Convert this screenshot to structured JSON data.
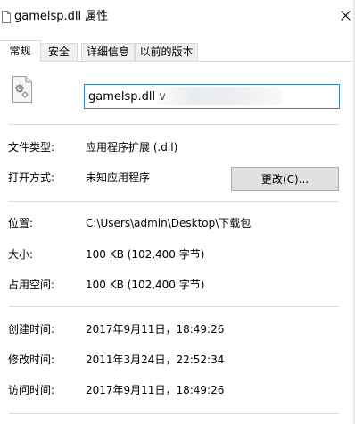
{
  "window": {
    "title": "gamelsp.dll 属性"
  },
  "tabs": [
    {
      "label": "常规"
    },
    {
      "label": "安全"
    },
    {
      "label": "详细信息"
    },
    {
      "label": "以前的版本"
    }
  ],
  "file": {
    "name": "gamelsp.dll v"
  },
  "details": {
    "type_label": "文件类型:",
    "type_value": "应用程序扩展 (.dll)",
    "open_label": "打开方式:",
    "open_value": "未知应用程序",
    "change_button": "更改(C)...",
    "location_label": "位置:",
    "location_value": "C:\\Users\\admin\\Desktop\\下载包",
    "size_label": "大小:",
    "size_value": "100 KB (102,400 字节)",
    "disk_label": "占用空间:",
    "disk_value": "100 KB (102,400 字节)",
    "created_label": "创建时间:",
    "created_value": "2017年9月11日，18:49:26",
    "modified_label": "修改时间:",
    "modified_value": "2011年3月24日，22:52:34",
    "accessed_label": "访问时间:",
    "accessed_value": "2017年9月11日，18:49:26"
  },
  "icons": {
    "title": "document-icon",
    "close": "close-icon",
    "file": "dll-file-icon"
  }
}
